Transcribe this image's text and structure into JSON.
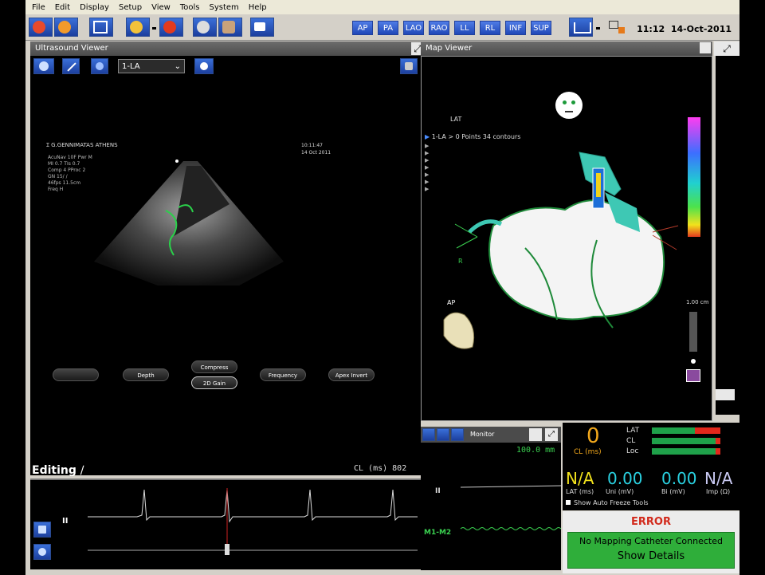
{
  "menu": [
    "File",
    "Edit",
    "Display",
    "Setup",
    "View",
    "Tools",
    "System",
    "Help"
  ],
  "view_buttons": [
    "AP",
    "PA",
    "LAO",
    "RAO",
    "LL",
    "RL",
    "INF",
    "SUP"
  ],
  "clock": {
    "time": "11:12",
    "date": "14-Oct-2011"
  },
  "ultrasound": {
    "title": "Ultrasound Viewer",
    "map_select": "1-LA",
    "hospital": "G.GENNIMATAS ATHENS",
    "image_time": "10:11:47",
    "image_date": "14 Oct 2011",
    "params": [
      "AcuNav 10F  Pwr M",
      "MI 0.7  TIs 0.7",
      "Comp 4  PProc 2",
      "GN 15/  /",
      "46fps  11.5cm",
      "Freq H"
    ],
    "controls": {
      "blank": "",
      "depth": "Depth",
      "compress": "Compress",
      "gain": "2D Gain",
      "frequency": "Frequency",
      "apex": "Apex Invert"
    },
    "editing": "Editing",
    "cl": "CL (ms)  802",
    "ecg_lead": "II"
  },
  "map": {
    "title": "Map Viewer",
    "mode": "LAT",
    "map_line": "1-LA > 0 Points 34 contours",
    "orient": "AP",
    "r_label": "R",
    "scale": "1.00 cm"
  },
  "monitor": {
    "title": "Monitor",
    "speed": "100.0 mm",
    "lead1": "II",
    "lead2": "M1-M2"
  },
  "status": {
    "cl_value": "0",
    "cl_label": "CL (ms)",
    "bars": [
      "LAT",
      "CL",
      "Loc"
    ],
    "lat_value": "N/A",
    "lat_label": "LAT (ms)",
    "uni_value": "0.00",
    "uni_label": "Uni (mV)",
    "bi_value": "0.00",
    "bi_label": "Bi (mV)",
    "imp_value": "N/A",
    "imp_label": "Imp (Ω)",
    "auto_freeze": "Show Auto Freeze Tools"
  },
  "error": {
    "title": "ERROR",
    "message": "No Mapping Catheter Connected",
    "details": "Show Details"
  }
}
